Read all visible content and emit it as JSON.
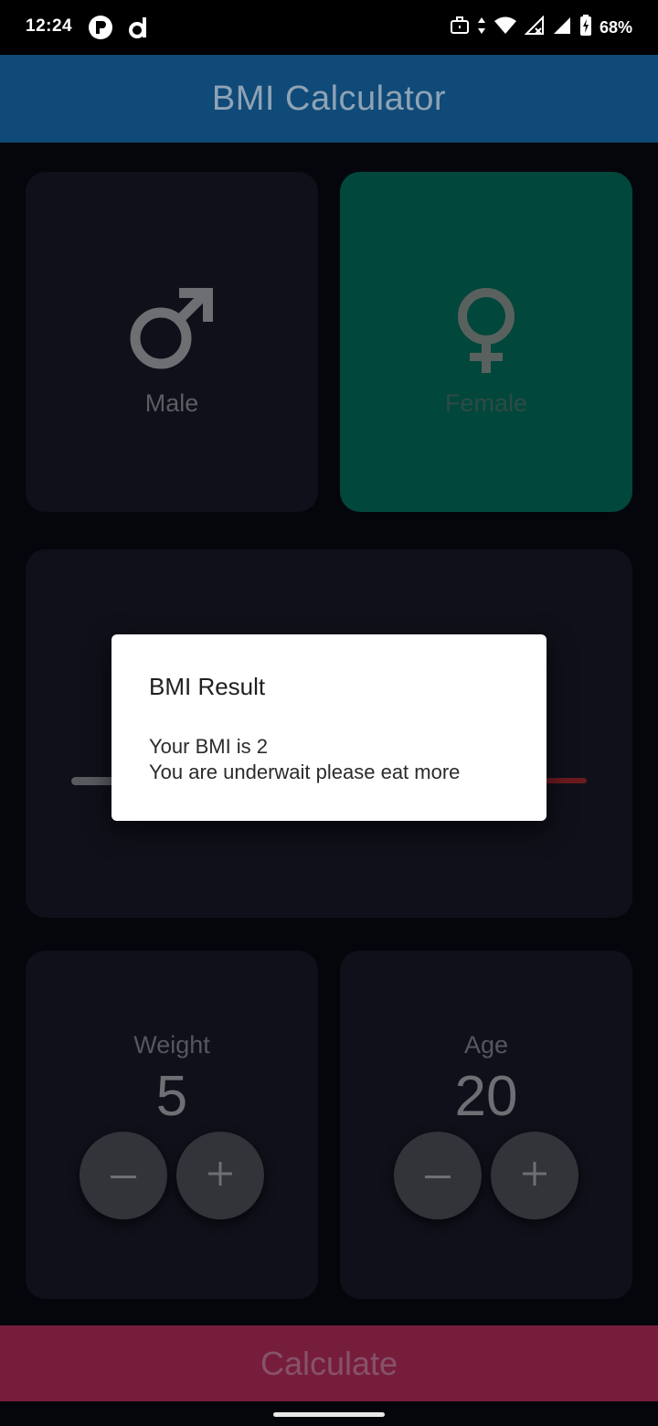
{
  "status_bar": {
    "time": "12:24",
    "battery_text": "68%",
    "left_icons": [
      "app-r-icon",
      "app-d-icon"
    ],
    "right_icons": [
      "briefcase-icon",
      "data-arrows-icon",
      "wifi-icon",
      "signal-icon",
      "signal-icon",
      "battery-charging-icon"
    ]
  },
  "app_bar": {
    "title": "BMI Calculator"
  },
  "gender": {
    "male_label": "Male",
    "female_label": "Female",
    "selected": "Female"
  },
  "weight": {
    "label": "Weight",
    "value": "5"
  },
  "age": {
    "label": "Age",
    "value": "20"
  },
  "calculate_label": "Calculate",
  "dialog": {
    "title": "BMI Result",
    "line1": "Your BMI is 2",
    "line2": "You are underwait please eat more"
  },
  "colors": {
    "app_bar": "#0f4a78",
    "card": "#0f1019",
    "selected_card": "#02473c",
    "calculate": "#771d3c"
  }
}
